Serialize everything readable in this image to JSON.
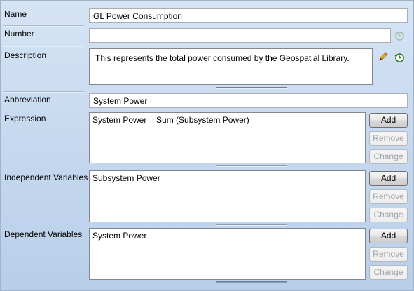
{
  "fields": {
    "name": {
      "label": "Name",
      "value": "GL Power Consumption"
    },
    "number": {
      "label": "Number",
      "value": ""
    },
    "description": {
      "label": "Description",
      "value": "This represents the total power consumed by the Geospatial Library."
    },
    "abbreviation": {
      "label": "Abbreviation",
      "value": "System Power"
    },
    "expression": {
      "label": "Expression",
      "value": "System Power = Sum (Subsystem Power)"
    },
    "independent_variables": {
      "label": "Independent Variables",
      "value": "Subsystem Power"
    },
    "dependent_variables": {
      "label": "Dependent Variables",
      "value": "System Power"
    }
  },
  "buttons": {
    "add": "Add",
    "remove": "Remove",
    "change": "Change"
  },
  "icons": {
    "number_history": "history-icon",
    "description_edit": "pencil-icon",
    "description_history": "history-icon"
  }
}
